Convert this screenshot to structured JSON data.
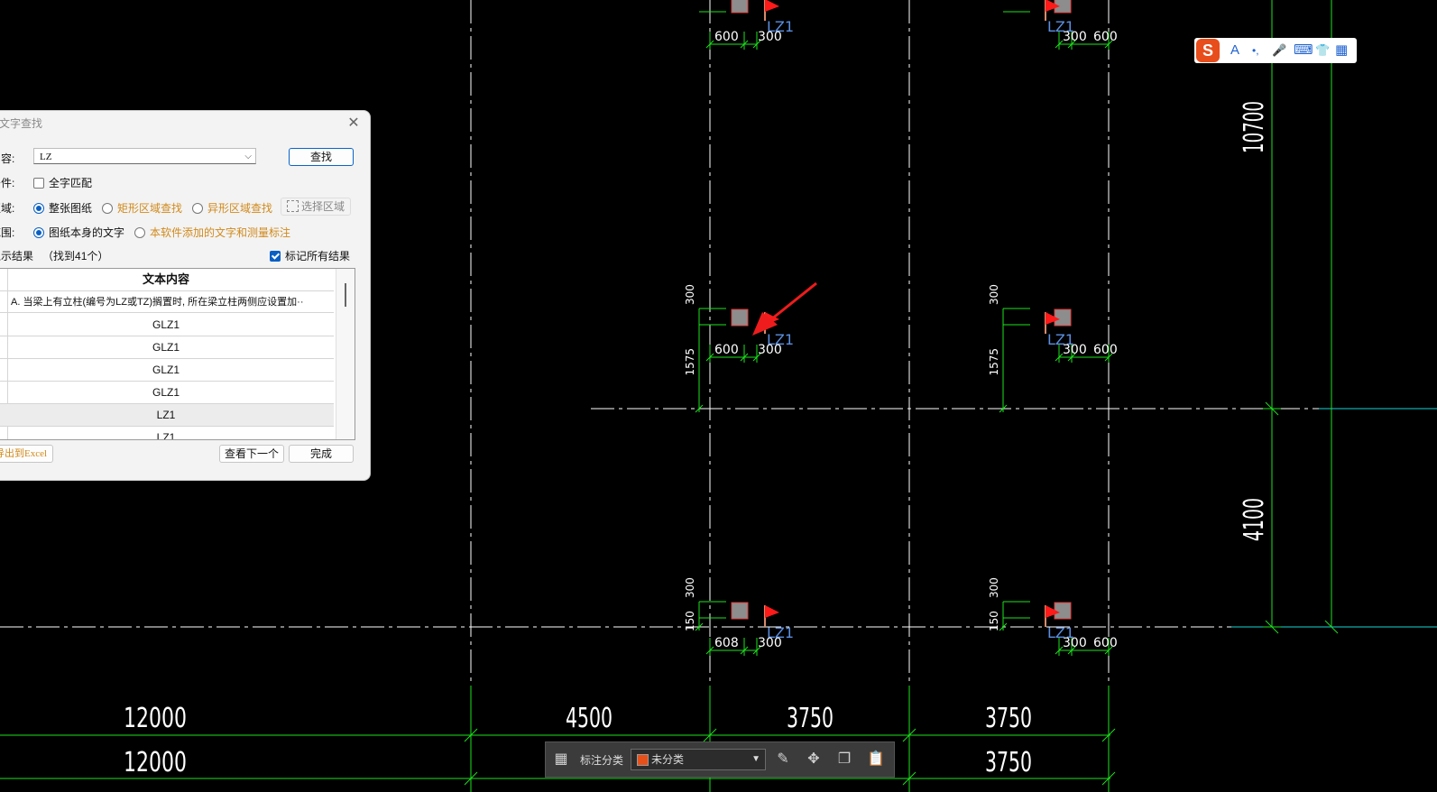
{
  "dialog": {
    "title": "文字查找",
    "content_label": "内容:",
    "search_value": "LZ",
    "find_button": "查找",
    "condition_label": "条件:",
    "full_match": "全字匹配",
    "full_match_checked": false,
    "area_label": "区域:",
    "area_options": [
      "整张图纸",
      "矩形区域查找",
      "异形区域查找"
    ],
    "select_area_button": "选择区域",
    "range_label": "范围:",
    "range_options": [
      "图纸本身的文字",
      "本软件添加的文字和测量标注"
    ],
    "results_label": "显示结果",
    "results_count": "（找到41个）",
    "mark_all": "标记所有结果",
    "mark_all_checked": true,
    "table_header": "文本内容",
    "rows": [
      "A.  当梁上有立柱(编号为LZ或TZ)搁置时, 所在梁立柱两侧应设置加··",
      "GLZ1",
      "GLZ1",
      "GLZ1",
      "GLZ1",
      "LZ1",
      "LZ1"
    ],
    "export_button": "导出到Excel",
    "next_button": "查看下一个",
    "done_button": "完成"
  },
  "toolbar": {
    "category_label": "标注分类",
    "category_value": "未分类",
    "category_color": "#e8501a"
  },
  "cad": {
    "bottom_dims_row1": [
      "12000",
      "4500",
      "3750",
      "3750"
    ],
    "bottom_dims_row2": [
      "12000",
      "3750"
    ],
    "right_dims": [
      "10700",
      "4100"
    ],
    "column_label": "LZ1",
    "dim_values": {
      "top": "300",
      "mid": "1575",
      "low": "150",
      "left": "600",
      "right": "300"
    }
  },
  "ime": {
    "letters": [
      "S",
      "A",
      "•,",
      "🎤",
      "⌨",
      "👕",
      "▦"
    ]
  }
}
